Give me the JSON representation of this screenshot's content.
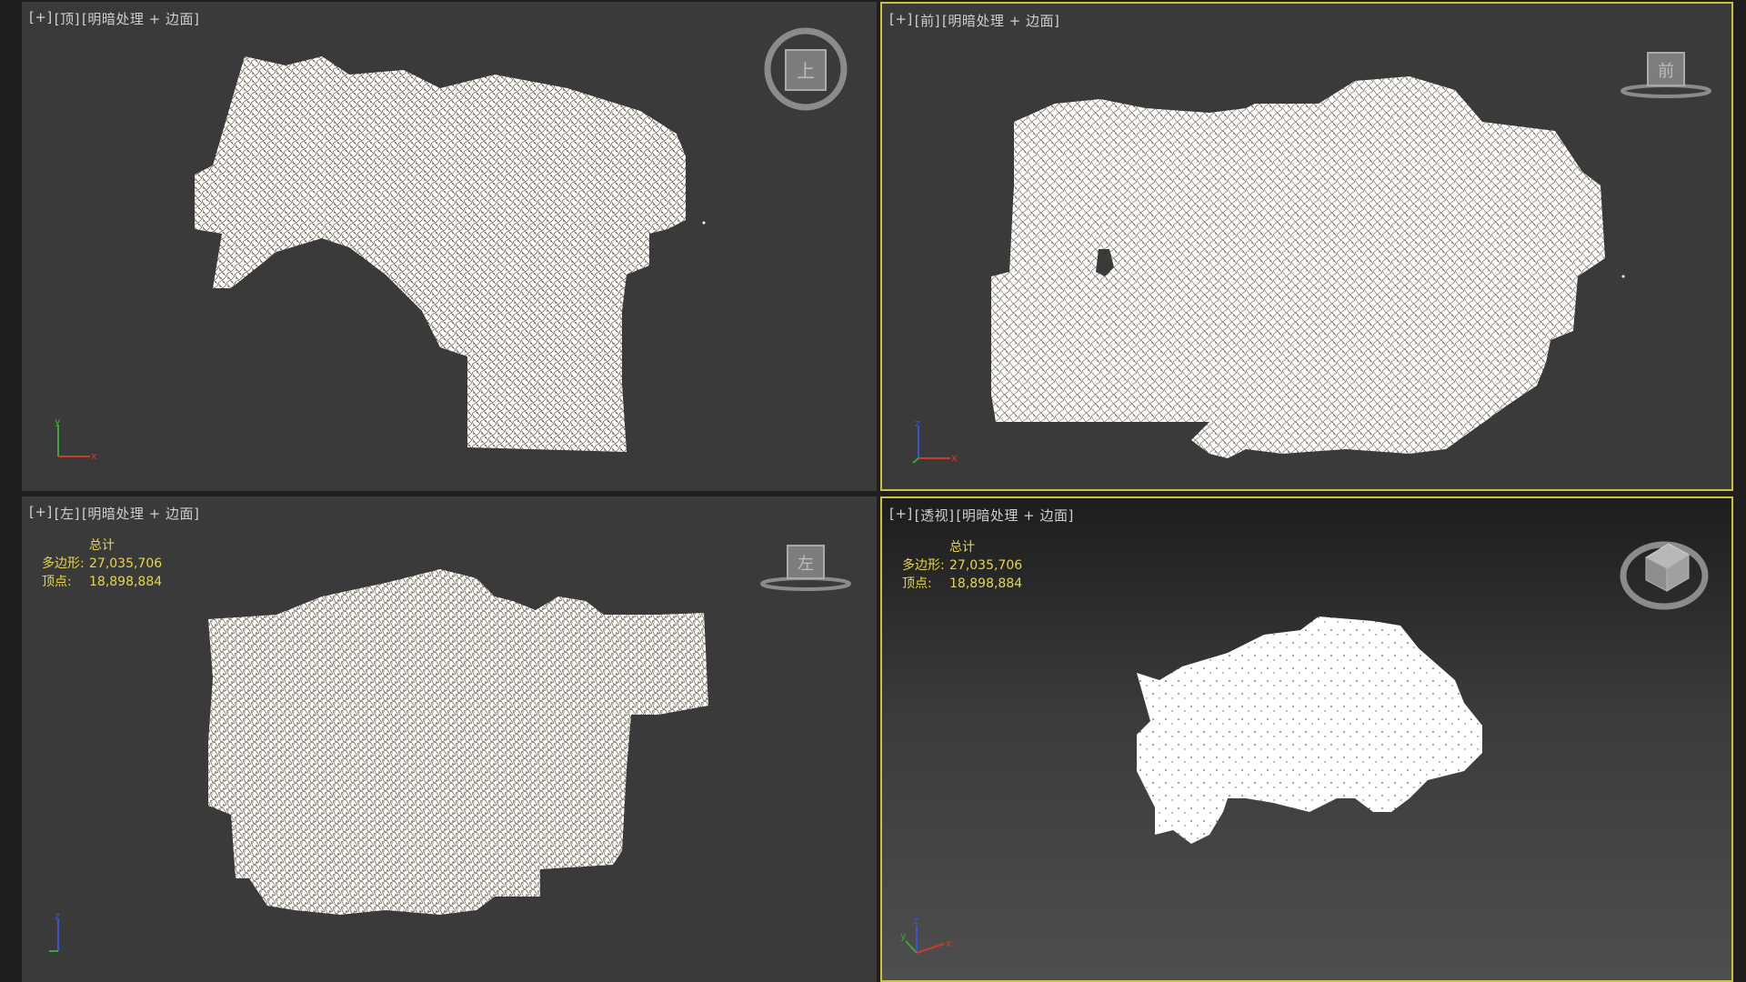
{
  "viewports": [
    {
      "id": "top",
      "label_plus": "[+]",
      "label_view": "[顶]",
      "label_shading": "[明暗处理 + 边面]",
      "viewcube_text": "上",
      "active": false
    },
    {
      "id": "front",
      "label_plus": "[+]",
      "label_view": "[前]",
      "label_shading": "[明暗处理 + 边面]",
      "viewcube_text": "前",
      "active": true
    },
    {
      "id": "left",
      "label_plus": "[+]",
      "label_view": "[左]",
      "label_shading": "[明暗处理 + 边面]",
      "viewcube_text": "左",
      "active": false,
      "stats": {
        "total": "总计",
        "poly_label": "多边形:",
        "poly_value": "27,035,706",
        "vert_label": "顶点:",
        "vert_value": "18,898,884"
      }
    },
    {
      "id": "perspective",
      "label_plus": "[+]",
      "label_view": "[透视]",
      "label_shading": "[明暗处理 + 边面]",
      "viewcube_text": "",
      "active": true,
      "stats": {
        "total": "总计",
        "poly_label": "多边形:",
        "poly_value": "27,035,706",
        "vert_label": "顶点:",
        "vert_value": "18,898,884"
      }
    }
  ],
  "colors": {
    "active_border": "#c9c23a",
    "stats_text": "#e8d64a",
    "axis_x": "#d03a2a",
    "axis_y": "#3aa83a",
    "axis_z": "#3a55d0",
    "mesh": "#ffffff"
  },
  "icons": [
    "viewcube-icon",
    "axis-tripod-icon"
  ]
}
